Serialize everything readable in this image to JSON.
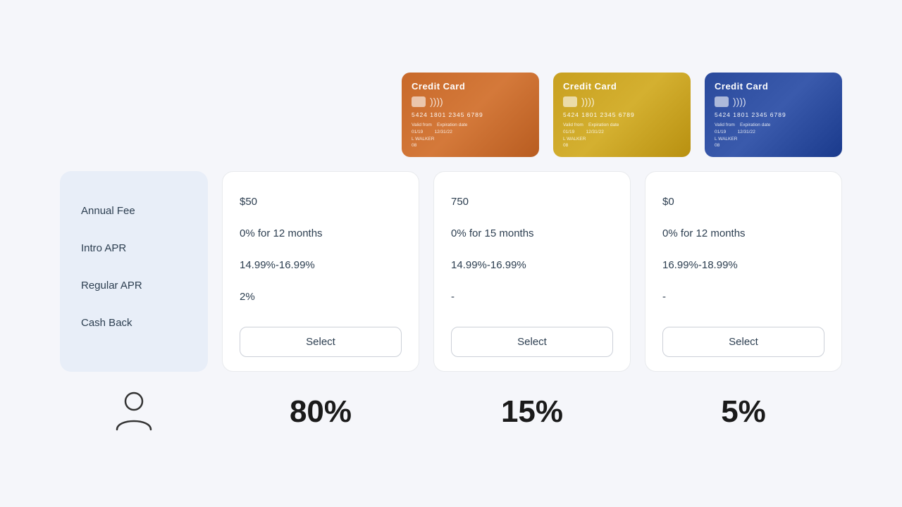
{
  "cards": [
    {
      "id": "card-orange",
      "title": "Credit Card",
      "number": "5424  1801  2345  6789",
      "valid_from": "01/19",
      "expiration": "12/31/22",
      "holder": "L WALKER",
      "cv": "08",
      "color": "orange"
    },
    {
      "id": "card-gold",
      "title": "Credit Card",
      "number": "5424  1801  2345  6789",
      "valid_from": "01/19",
      "expiration": "12/31/22",
      "holder": "L WALKER",
      "cv": "08",
      "color": "gold"
    },
    {
      "id": "card-blue",
      "title": "Credit Card",
      "number": "5424  1801  2345  6789",
      "valid_from": "01/19",
      "expiration": "12/31/22",
      "holder": "L WALKER",
      "cv": "08",
      "color": "blue"
    }
  ],
  "labels": {
    "annual_fee": "Annual Fee",
    "intro_apr": "Intro APR",
    "regular_apr": "Regular APR",
    "cash_back": "Cash Back"
  },
  "products": [
    {
      "id": "product-1",
      "annual_fee": "$50",
      "intro_apr": "0% for 12 months",
      "regular_apr": "14.99%-16.99%",
      "cash_back": "2%",
      "select_label": "Select"
    },
    {
      "id": "product-2",
      "annual_fee": "750",
      "intro_apr": "0% for 15 months",
      "regular_apr": "14.99%-16.99%",
      "cash_back": "-",
      "select_label": "Select"
    },
    {
      "id": "product-3",
      "annual_fee": "$0",
      "intro_apr": "0% for 12 months",
      "regular_apr": "16.99%-18.99%",
      "cash_back": "-",
      "select_label": "Select"
    }
  ],
  "percentages": [
    {
      "id": "pct-1",
      "value": "80%"
    },
    {
      "id": "pct-2",
      "value": "15%"
    },
    {
      "id": "pct-3",
      "value": "5%"
    }
  ],
  "avatar": {
    "label": "user-avatar"
  }
}
